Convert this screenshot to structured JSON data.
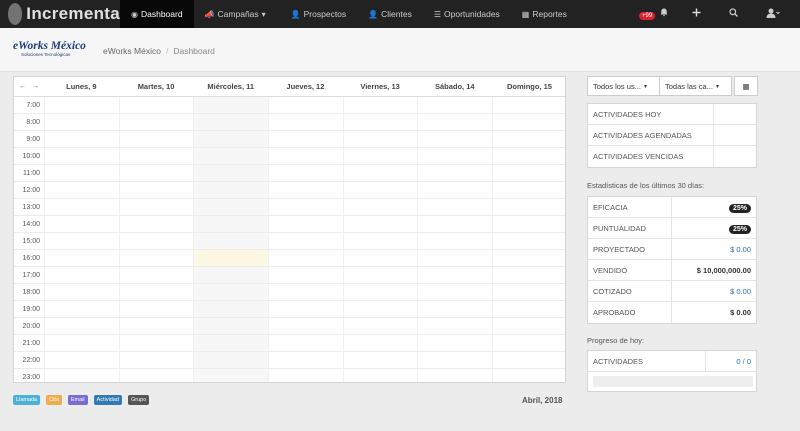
{
  "navbar": {
    "brand": "Incrementa",
    "items": [
      {
        "label": "Dashboard",
        "icon": "dashboard-icon",
        "glyph": "◉",
        "active": true
      },
      {
        "label": "Campañas",
        "icon": "bullhorn-icon",
        "glyph": "📣",
        "caret": "▾"
      },
      {
        "label": "Prospectos",
        "icon": "user-icon",
        "glyph": "👤"
      },
      {
        "label": "Clientes",
        "icon": "user-icon",
        "glyph": "👤"
      },
      {
        "label": "Oportunidades",
        "icon": "list-icon",
        "glyph": "☰"
      },
      {
        "label": "Reportes",
        "icon": "chart-icon",
        "glyph": "▦"
      }
    ],
    "notifications": "+99"
  },
  "logo": {
    "main": "eWorks México",
    "sub": "Soluciones Tecnológicas"
  },
  "breadcrumb": {
    "root": "eWorks México",
    "current": "Dashboard"
  },
  "calendar": {
    "nav_prev": "←",
    "nav_next": "→",
    "days": [
      "Lunes, 9",
      "Martes, 10",
      "Miércoles, 11",
      "Jueves, 12",
      "Viernes, 13",
      "Sábado, 14",
      "Domingo, 15"
    ],
    "hours": [
      "7:00",
      "8:00",
      "9:00",
      "10:00",
      "11:00",
      "12:00",
      "13:00",
      "14:00",
      "15:00",
      "16:00",
      "17:00",
      "18:00",
      "19:00",
      "20:00",
      "21:00",
      "22:00",
      "23:00"
    ],
    "month": "Abril, 2018"
  },
  "legend": [
    {
      "label": "Llamada",
      "color": "#4eb0d4"
    },
    {
      "label": "Cita",
      "color": "#f0ad4e"
    },
    {
      "label": "Email",
      "color": "#7a6bd0"
    },
    {
      "label": "Actividad",
      "color": "#337ab7"
    },
    {
      "label": "Grupo",
      "color": "#555555"
    }
  ],
  "filters": {
    "users": "Todos los us...",
    "categories": "Todas las ca...",
    "caret": "▾",
    "calendar_glyph": "▦"
  },
  "counters": [
    "ACTIVIDADES HOY",
    "ACTIVIDADES AGENDADAS",
    "ACTIVIDADES VENCIDAS"
  ],
  "stats": {
    "title": "Estadísticas de los últimos 30 días:",
    "rows": [
      {
        "label": "EFICACIA",
        "value": "25%"
      },
      {
        "label": "PUNTUALIDAD",
        "value": "25%"
      },
      {
        "label": "PROYECTADO",
        "value": "$ 0.00"
      },
      {
        "label": "VENDIDO",
        "value": "$ 10,000,000.00"
      },
      {
        "label": "COTIZADO",
        "value": "$ 0.00"
      },
      {
        "label": "APROBADO",
        "value": "$ 0.00"
      }
    ]
  },
  "progress": {
    "title": "Progreso de hoy:",
    "label": "ACTIVIDADES",
    "value": "0 / 0"
  },
  "colors": {
    "navbar": "#222222",
    "accent_blue": "#2f6fb5",
    "today_highlight": "#fcf8e3"
  }
}
